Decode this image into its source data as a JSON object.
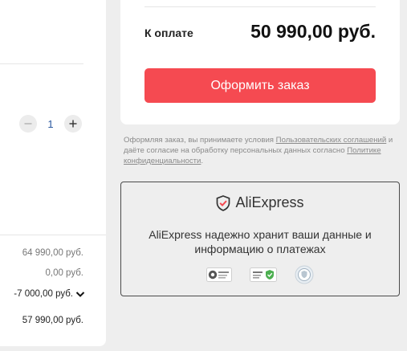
{
  "cart": {
    "quantity": "1",
    "item_price": "64 990,00 руб.",
    "delivery": "0,00 руб.",
    "discount": "-7 000,00 руб.",
    "subtotal": "57 990,00 руб."
  },
  "summary": {
    "total_label": "К оплате",
    "total_amount": "50 990,00 руб.",
    "order_button": "Оформить заказ"
  },
  "terms": {
    "part1": "Оформляя заказ, вы принимаете условия ",
    "link1": "Пользовательских соглашений",
    "part2": " и даёте согласие на обработку персональных данных согласно ",
    "link2": "Политике конфиденциальности",
    "part3": "."
  },
  "security": {
    "brand": "AliExpress",
    "message": "AliExpress надежно хранит ваши данные и информацию о платежах",
    "badges": [
      "pci-dss-badge-icon",
      "verified-secure-badge-icon",
      "security-seal-badge-icon"
    ]
  },
  "colors": {
    "accent": "#f54a51",
    "qty_text": "#2c5aa0",
    "background": "#eeeeee"
  }
}
